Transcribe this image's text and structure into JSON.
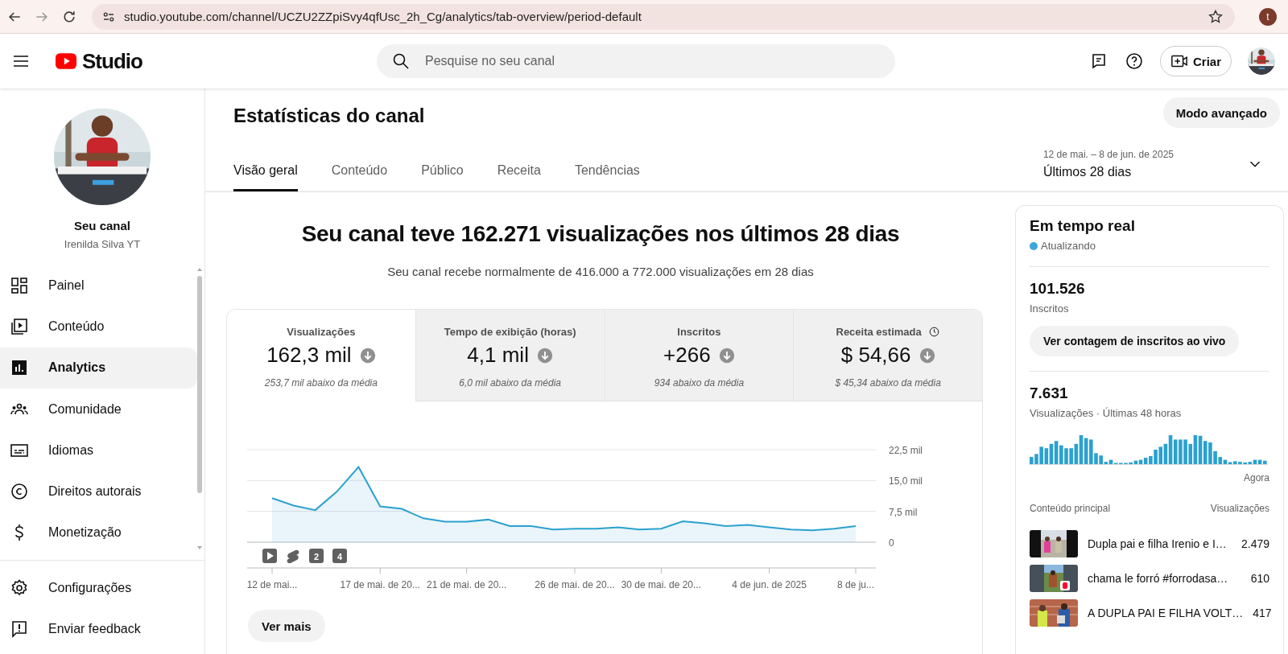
{
  "browser": {
    "url": "studio.youtube.com/channel/UCZU2ZZpiSvy4qfUsc_2h_Cg/analytics/tab-overview/period-default",
    "profile_initial": "t"
  },
  "header": {
    "logo_text": "Studio",
    "search": {
      "placeholder": "Pesquise no seu canal"
    },
    "create_button": "Criar"
  },
  "sidebar": {
    "channel_title": "Seu canal",
    "channel_name": "Irenilda Silva YT",
    "items": [
      {
        "label": "Painel",
        "selected": false
      },
      {
        "label": "Conteúdo",
        "selected": false
      },
      {
        "label": "Analytics",
        "selected": true
      },
      {
        "label": "Comunidade",
        "selected": false
      },
      {
        "label": "Idiomas",
        "selected": false
      },
      {
        "label": "Direitos autorais",
        "selected": false
      },
      {
        "label": "Monetização",
        "selected": false
      }
    ],
    "footer_items": [
      {
        "label": "Configurações"
      },
      {
        "label": "Enviar feedback"
      }
    ]
  },
  "page": {
    "title": "Estatísticas do canal",
    "advanced_button": "Modo avançado",
    "tabs": [
      {
        "label": "Visão geral",
        "selected": true
      },
      {
        "label": "Conteúdo",
        "selected": false
      },
      {
        "label": "Público",
        "selected": false
      },
      {
        "label": "Receita",
        "selected": false
      },
      {
        "label": "Tendências",
        "selected": false
      }
    ],
    "period": {
      "range": "12 de mai. – 8 de jun. de 2025",
      "label": "Últimos 28 dias"
    }
  },
  "overview": {
    "headline": "Seu canal teve 162.271 visualizações nos últimos 28 dias",
    "subtitle": "Seu canal recebe normalmente de 416.000 a 772.000 visualizações em 28 dias",
    "metrics": [
      {
        "label": "Visualizações",
        "value": "162,3 mil",
        "comparison": "253,7 mil abaixo da média",
        "selected": true,
        "clock": false
      },
      {
        "label": "Tempo de exibição (horas)",
        "value": "4,1 mil",
        "comparison": "6,0 mil abaixo da média",
        "selected": false,
        "clock": false
      },
      {
        "label": "Inscritos",
        "value": "+266",
        "comparison": "934 abaixo da média",
        "selected": false,
        "clock": false
      },
      {
        "label": "Receita estimada",
        "value": "$ 54,66",
        "comparison": "$ 45,34 abaixo da média",
        "selected": false,
        "clock": true
      }
    ],
    "chart_data": {
      "type": "area",
      "categories": [
        "12 de mai...",
        null,
        null,
        null,
        null,
        "17 de mai. de 20...",
        null,
        null,
        null,
        "21 de mai. de 20...",
        null,
        null,
        null,
        null,
        "26 de mai. de 20...",
        null,
        null,
        null,
        "30 de mai. de 20...",
        null,
        null,
        null,
        null,
        "4 de jun. de 2025",
        null,
        null,
        null,
        "8 de ju..."
      ],
      "series": [
        {
          "color": "#2ba1cf",
          "values": [
            10.7,
            8.9,
            7.8,
            12.3,
            18.3,
            8.7,
            8.1,
            5.8,
            5.0,
            5.0,
            5.5,
            3.9,
            3.9,
            3.1,
            3.3,
            3.3,
            3.6,
            3.1,
            3.3,
            5.1,
            4.6,
            3.9,
            4.2,
            3.6,
            3.1,
            2.9,
            3.3,
            3.9
          ]
        }
      ],
      "ylim": [
        0,
        22.5
      ],
      "yticks": [
        {
          "value": 0,
          "label": "0"
        },
        {
          "value": 7.5,
          "label": "7,5 mil"
        },
        {
          "value": 15,
          "label": "15,0 mil"
        },
        {
          "value": 22.5,
          "label": "22,5 mil"
        }
      ]
    },
    "markers": [
      {
        "kind": "video"
      },
      {
        "kind": "short"
      },
      {
        "kind": "count",
        "label": "2"
      },
      {
        "kind": "count",
        "label": "4"
      }
    ],
    "more_button": "Ver mais"
  },
  "realtime": {
    "title": "Em tempo real",
    "status": "Atualizando",
    "subscribers": "101.526",
    "subscribers_label": "Inscritos",
    "live_button": "Ver contagem de inscritos ao vivo",
    "views": "7.631",
    "views_label": "Visualizações · Últimas 48 horas",
    "now_label": "Agora",
    "top_content": {
      "title_header": "Conteúdo principal",
      "views_header": "Visualizações",
      "items": [
        {
          "title": "Dupla pai e filha Irenio e I…",
          "views": "2.479"
        },
        {
          "title": "chama le forró #forrodasa…",
          "views": "610"
        },
        {
          "title": "A DUPLA PAI E FILHA VOLT…",
          "views": "417"
        }
      ]
    }
  }
}
